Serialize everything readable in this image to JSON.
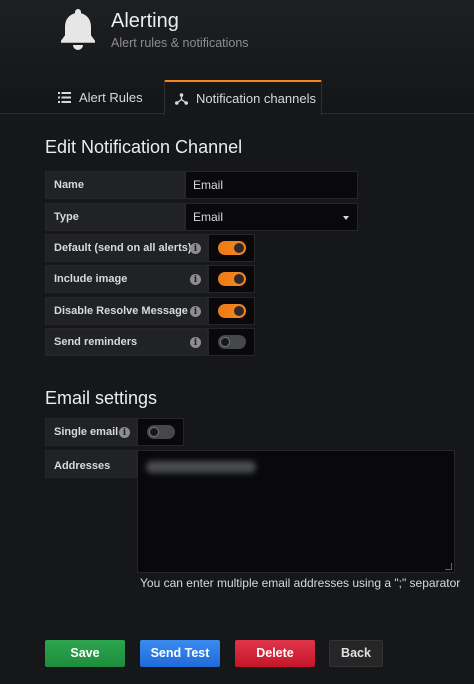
{
  "header": {
    "title": "Alerting",
    "subtitle": "Alert rules & notifications",
    "icon": "bell-icon"
  },
  "tabs": [
    {
      "label": "Alert Rules",
      "icon": "list-icon",
      "active": false
    },
    {
      "label": "Notification channels",
      "icon": "channels-icon",
      "active": true
    }
  ],
  "edit": {
    "title": "Edit Notification Channel",
    "name_label": "Name",
    "name_value": "Email",
    "type_label": "Type",
    "type_value": "Email",
    "toggles": [
      {
        "label": "Default (send on all alerts)",
        "on": true
      },
      {
        "label": "Include image",
        "on": true
      },
      {
        "label": "Disable Resolve Message",
        "on": true
      },
      {
        "label": "Send reminders",
        "on": false
      }
    ]
  },
  "email": {
    "title": "Email settings",
    "single_label": "Single email",
    "single_on": false,
    "addresses_label": "Addresses",
    "hint": "You can enter multiple email addresses using a \";\" separator"
  },
  "buttons": {
    "save": "Save",
    "send_test": "Send Test",
    "delete": "Delete",
    "back": "Back"
  },
  "colors": {
    "accent": "#f5861f",
    "save": "#1d8e3d",
    "test": "#1f6ad8",
    "delete": "#c4162a"
  }
}
